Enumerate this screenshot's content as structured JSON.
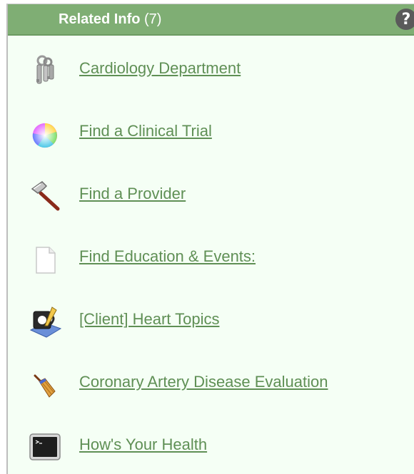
{
  "header": {
    "title": "Related Info",
    "count": "(7)",
    "help_label": "?"
  },
  "colors": {
    "header_bg": "#7fae74",
    "link": "#5f8f55",
    "panel_bg": "#f5fff5"
  },
  "items": [
    {
      "label": "Cardiology Department",
      "icon": "keys-icon"
    },
    {
      "label": "Find a Clinical Trial",
      "icon": "color-wheel-icon"
    },
    {
      "label": "Find a Provider",
      "icon": "hammer-icon"
    },
    {
      "label": "Find Education & Events:",
      "icon": "document-icon"
    },
    {
      "label": "[Client] Heart Topics",
      "icon": "script-editor-icon"
    },
    {
      "label": "Coronary Artery Disease Evaluation",
      "icon": "broom-icon"
    },
    {
      "label": "How's Your Health",
      "icon": "terminal-icon"
    }
  ]
}
